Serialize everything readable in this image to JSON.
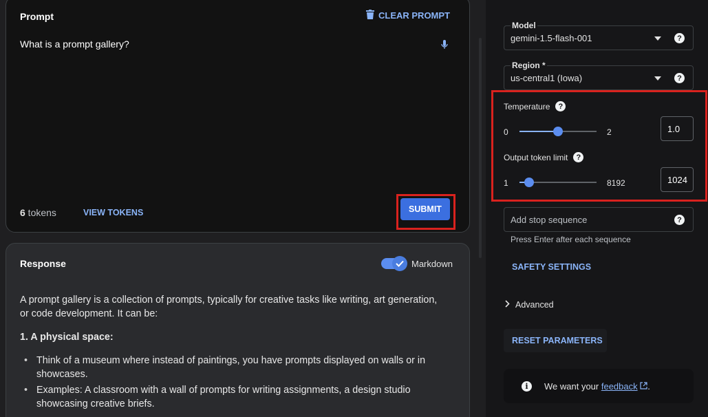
{
  "prompt": {
    "title": "Prompt",
    "clear_label": "CLEAR PROMPT",
    "text": "What is a prompt gallery?",
    "token_count": "6",
    "token_suffix": " tokens",
    "view_tokens_label": "VIEW TOKENS",
    "submit_label": "SUBMIT"
  },
  "response": {
    "title": "Response",
    "markdown_label": "Markdown",
    "markdown_enabled": true,
    "paragraph": "A prompt gallery is a collection of prompts, typically for creative tasks like writing, art generation, or code development. It can be:",
    "heading": "1. A physical space:",
    "bullets": [
      "Think of a museum where instead of paintings, you have prompts displayed on walls or in showcases.",
      "Examples: A classroom with a wall of prompts for writing assignments, a design studio showcasing creative briefs."
    ]
  },
  "settings": {
    "model": {
      "label": "Model",
      "value": "gemini-1.5-flash-001"
    },
    "region": {
      "label": "Region *",
      "value": "us-central1 (Iowa)"
    },
    "temperature": {
      "label": "Temperature",
      "min": "0",
      "max": "2",
      "value": "1.0",
      "fraction": 0.5
    },
    "output_limit": {
      "label": "Output token limit",
      "min": "1",
      "max": "8192",
      "value": "1024",
      "fraction": 0.125
    },
    "stop_sequence": {
      "placeholder": "Add stop sequence",
      "hint": "Press Enter after each sequence"
    },
    "safety_label": "SAFETY SETTINGS",
    "advanced_label": "Advanced",
    "reset_label": "RESET PARAMETERS",
    "feedback": {
      "prefix": "We want your ",
      "link": "feedback",
      "suffix": "."
    }
  },
  "colors": {
    "accent": "#8ab4f8",
    "submit": "#3b6fe0",
    "highlight": "#d9221e"
  }
}
